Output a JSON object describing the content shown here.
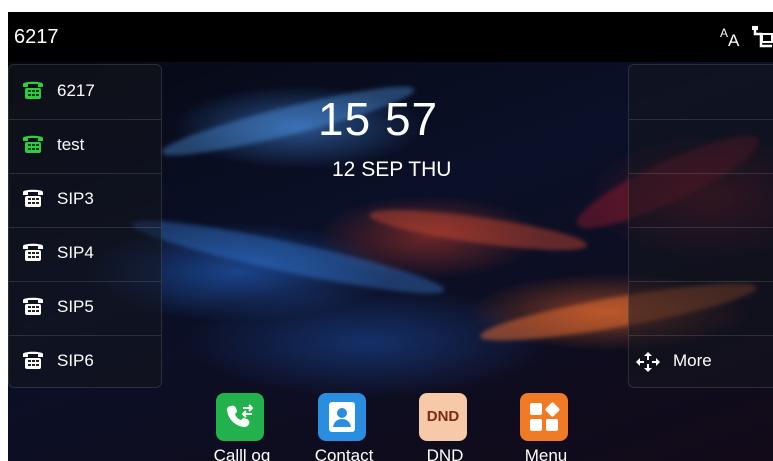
{
  "status_bar": {
    "title": "6217",
    "font_icon": "font-size-icon",
    "network_icon": "network-icon"
  },
  "clock": {
    "time": "15 57",
    "date": "12 SEP THU"
  },
  "lines": [
    {
      "label": "6217",
      "state": "registered",
      "color": "#2ecc40"
    },
    {
      "label": "test",
      "state": "registered",
      "color": "#2ecc40"
    },
    {
      "label": "SIP3",
      "state": "idle",
      "color": "#ffffff"
    },
    {
      "label": "SIP4",
      "state": "idle",
      "color": "#ffffff"
    },
    {
      "label": "SIP5",
      "state": "idle",
      "color": "#ffffff"
    },
    {
      "label": "SIP6",
      "state": "idle",
      "color": "#ffffff"
    }
  ],
  "right_panel": {
    "more_label": "More"
  },
  "dock": [
    {
      "label": "Calll og",
      "icon": "call-log-icon",
      "color": "#22b14c"
    },
    {
      "label": "Contact",
      "icon": "contact-icon",
      "color": "#2a8ee0"
    },
    {
      "label": "DND",
      "icon": "dnd-icon",
      "icon_text": "DND",
      "color": "#f6c9a8"
    },
    {
      "label": "Menu",
      "icon": "menu-icon",
      "color": "#f07a25"
    }
  ]
}
